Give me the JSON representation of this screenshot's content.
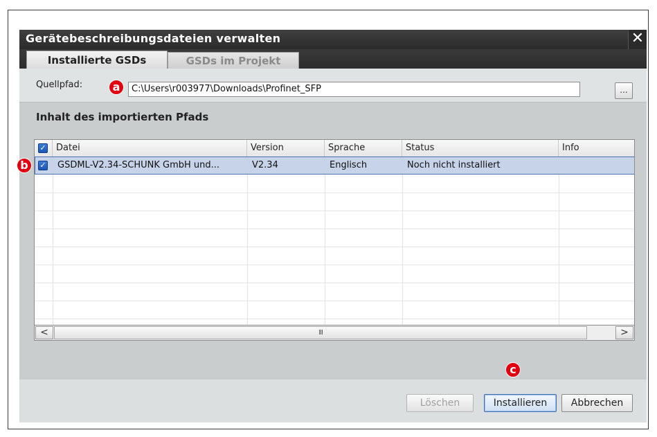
{
  "window": {
    "title": "Gerätebeschreibungsdateien verwalten",
    "close_glyph": "✕"
  },
  "tabs": [
    {
      "label": "Installierte GSDs",
      "active": true
    },
    {
      "label": "GSDs im Projekt",
      "active": false
    }
  ],
  "source": {
    "label": "Quellpfad:",
    "value": "C:\\Users\\r003977\\Downloads\\Profinet_SFP",
    "browse_label": "..."
  },
  "annotations": {
    "a": "a",
    "b": "b",
    "c": "c"
  },
  "content": {
    "title": "Inhalt des importierten Pfads",
    "columns": [
      "Datei",
      "Version",
      "Sprache",
      "Status",
      "Info"
    ],
    "rows": [
      {
        "datei": "GSDML-V2.34-SCHUNK GmbH und...",
        "version": "V2.34",
        "sprache": "Englisch",
        "status": "Noch nicht installiert",
        "info": "",
        "checked": true
      }
    ],
    "scroll_left_glyph": "<",
    "scroll_right_glyph": ">",
    "scroll_thumb_glyph": "III"
  },
  "buttons": {
    "delete": "Löschen",
    "install": "Installieren",
    "cancel": "Abbrechen"
  },
  "colors": {
    "annotation_badge": "#e10010",
    "selection": "#c7d3e8",
    "checkbox": "#2a66c6"
  }
}
